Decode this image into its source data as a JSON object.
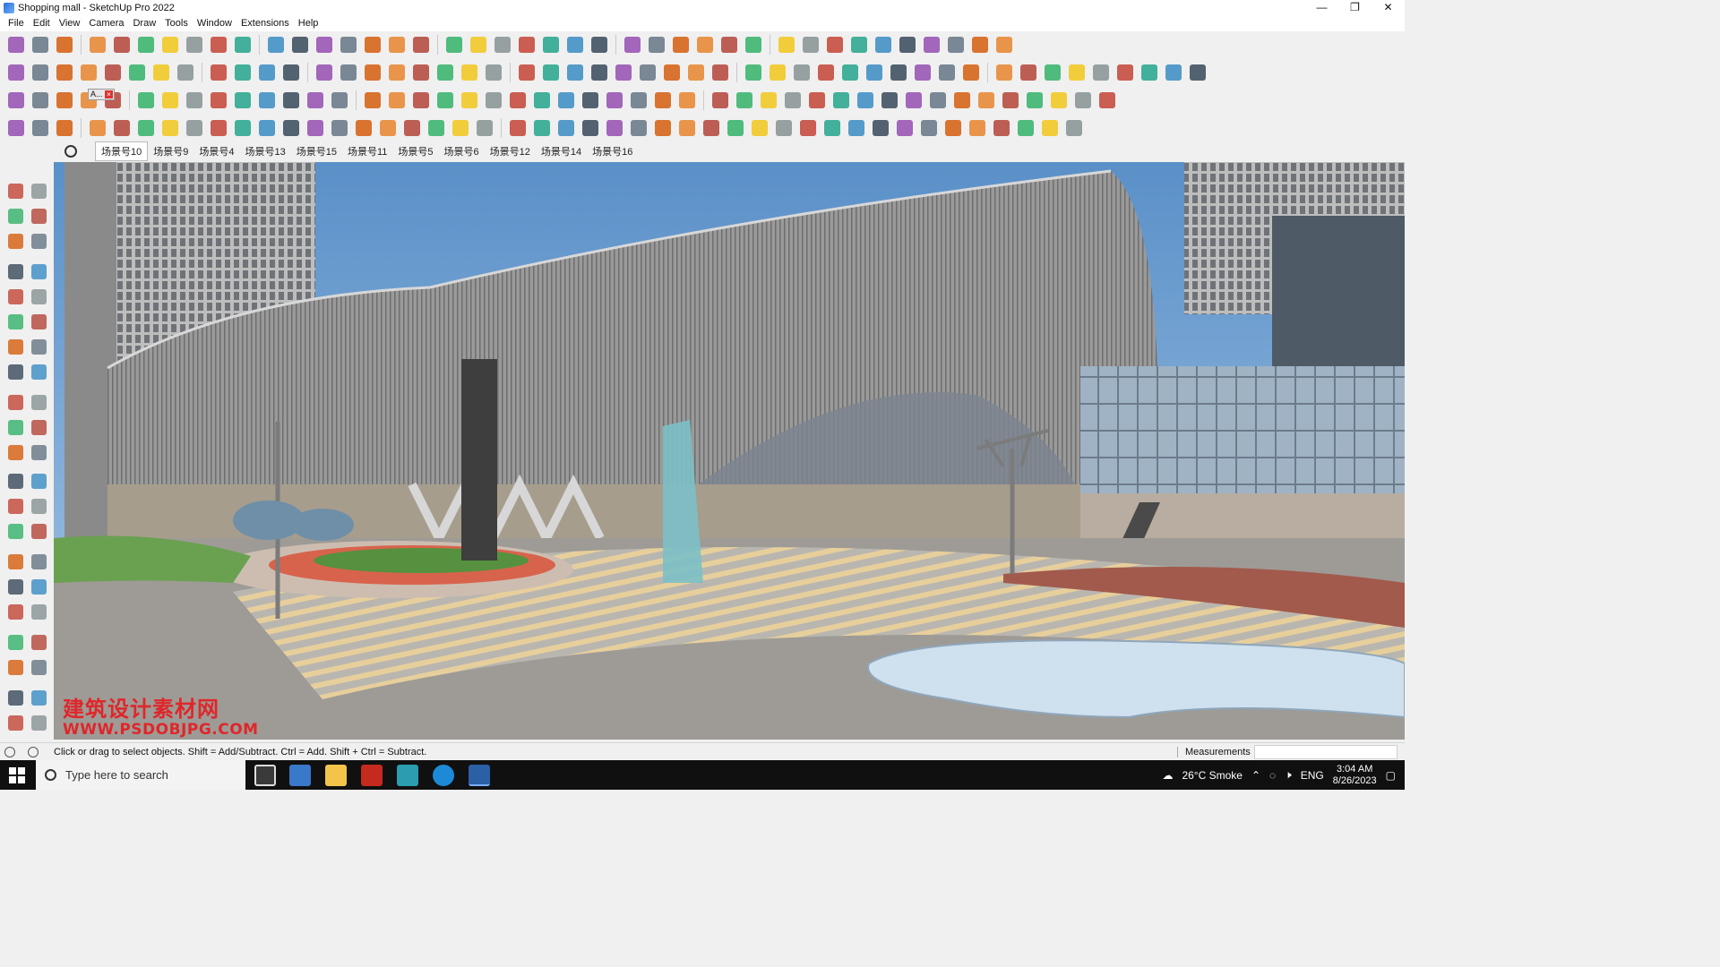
{
  "window": {
    "title": "Shopping mall - SketchUp Pro 2022",
    "controls": [
      "—",
      "❐",
      "✕"
    ]
  },
  "menu": [
    "File",
    "Edit",
    "View",
    "Camera",
    "Draw",
    "Tools",
    "Window",
    "Extensions",
    "Help"
  ],
  "scene_tabs": [
    "场景号10",
    "场景号9",
    "场景号4",
    "场景号13",
    "场景号15",
    "场景号11",
    "场景号5",
    "场景号6",
    "场景号12",
    "场景号14",
    "场景号16"
  ],
  "toolbar_popup_label": "A...",
  "watermark": {
    "chinese": "建筑设计素材网",
    "url": "WWW.PSDOBJPG.COM"
  },
  "status": {
    "hint": "Click or drag to select objects. Shift = Add/Subtract. Ctrl = Add. Shift + Ctrl = Subtract.",
    "measurements_label": "Measurements",
    "measurements_value": ""
  },
  "taskbar": {
    "search_placeholder": "Type here to search",
    "weather": "26°C  Smoke",
    "language": "ENG",
    "time": "3:04 AM",
    "date": "8/26/2023"
  },
  "colors": {
    "sky": "#5f96cc",
    "facade": "#8f8f8f",
    "plaza_stripe": "#e7cf9c",
    "pool": "#cfe0ef",
    "watermark": "#e0262a"
  }
}
